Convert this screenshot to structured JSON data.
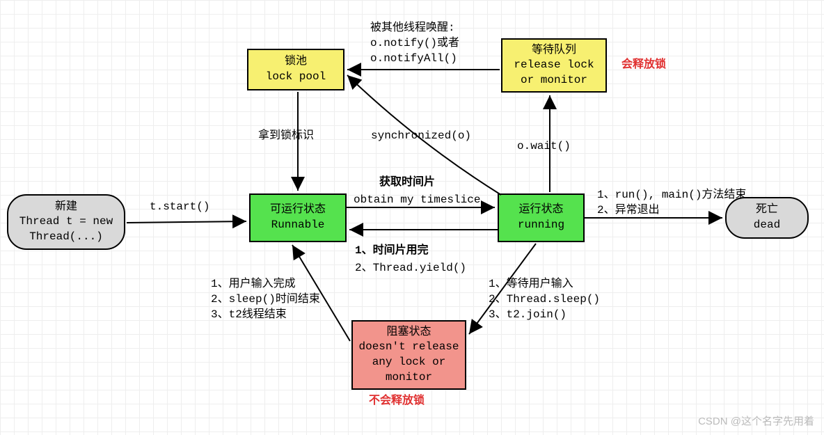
{
  "states": {
    "new": {
      "title": "新建",
      "sub1": "Thread t = new",
      "sub2": "Thread(...)"
    },
    "runnable": {
      "title": "可运行状态",
      "sub": "Runnable"
    },
    "running": {
      "title": "运行状态",
      "sub": "running"
    },
    "dead": {
      "title": "死亡",
      "sub": "dead"
    },
    "lockpool": {
      "title": "锁池",
      "sub": "lock pool"
    },
    "waitq": {
      "title": "等待队列",
      "sub1": "release lock",
      "sub2": "or monitor"
    },
    "blocked": {
      "title": "阻塞状态",
      "sub1": "doesn't release",
      "sub2": "any lock or",
      "sub3": "monitor"
    }
  },
  "edges": {
    "start_call": "t.start()",
    "got_lock_flag": "拿到锁标识",
    "wakeup_header": "被其他线程唤醒:",
    "wakeup_l1": "o.notify()或者",
    "wakeup_l2": "o.notifyAll()",
    "obtain_ts_cn": "获取时间片",
    "obtain_ts_en": "obtain my timeslice",
    "slice_used_1": "1、时间片用完",
    "slice_used_2": "2、Thread.yield()",
    "to_blocked_1": "1、等待用户输入",
    "to_blocked_2": "2、Thread.sleep()",
    "to_blocked_3": "3、t2.join()",
    "from_blocked_1": "1、用户输入完成",
    "from_blocked_2": "2、sleep()时间结束",
    "from_blocked_3": "3、t2线程结束",
    "synchronized_call": "synchronized(o)",
    "owait_call": "o.wait()",
    "to_dead_1": "1、run(), main()方法结束",
    "to_dead_2": "2、异常退出",
    "will_release": "会释放锁",
    "wont_release": "不会释放锁"
  },
  "watermark": "CSDN @这个名字先用着"
}
